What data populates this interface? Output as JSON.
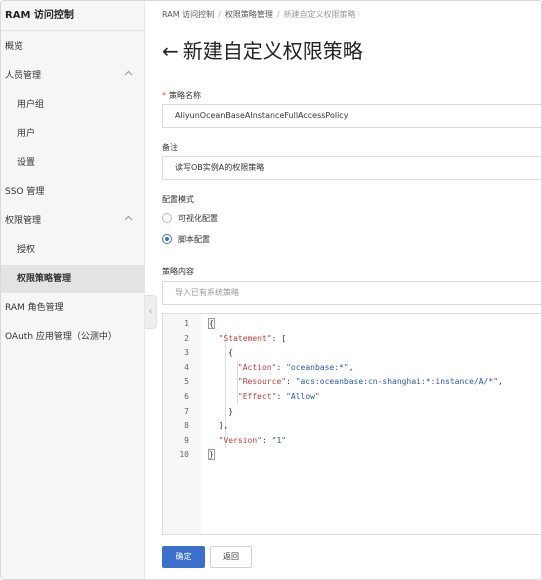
{
  "sidebar": {
    "title": "RAM 访问控制",
    "items": [
      {
        "label": "概览"
      },
      {
        "label": "人员管理"
      },
      {
        "label": "用户组"
      },
      {
        "label": "用户"
      },
      {
        "label": "设置"
      },
      {
        "label": "SSO 管理"
      },
      {
        "label": "权限管理"
      },
      {
        "label": "授权"
      },
      {
        "label": "权限策略管理"
      },
      {
        "label": "RAM 角色管理"
      },
      {
        "label": "OAuth 应用管理（公测中）"
      }
    ],
    "collapse_glyph": "‹"
  },
  "breadcrumb": {
    "items": [
      "RAM 访问控制",
      "权限策略管理",
      "新建自定义权限策略"
    ],
    "separator": "/"
  },
  "page": {
    "back_glyph": "←",
    "title": "新建自定义权限策略"
  },
  "form": {
    "policy_name_label": "策略名称",
    "required_mark": "*",
    "policy_name_value": "AliyunOceanBaseAInstanceFullAccessPolicy",
    "remark_label": "备注",
    "remark_value": "读写OB实例A的权限策略",
    "mode_label": "配置模式",
    "mode_options": [
      {
        "label": "可视化配置",
        "selected": false
      },
      {
        "label": "脚本配置",
        "selected": true
      }
    ],
    "content_label": "策略内容",
    "import_placeholder": "导入已有系统策略"
  },
  "editor": {
    "line_numbers": [
      "1",
      "2",
      "3",
      "4",
      "5",
      "6",
      "7",
      "8",
      "9",
      "10"
    ],
    "lines": [
      {
        "indent": "",
        "parts": [
          "{"
        ]
      },
      {
        "indent": "  ",
        "key": "\"Statement\"",
        "rest": ": ["
      },
      {
        "indent": "    ",
        "parts": [
          "{"
        ]
      },
      {
        "indent": "      ",
        "key": "\"Action\"",
        "sep": ": ",
        "val": "\"oceanbase:*\"",
        "tail": ","
      },
      {
        "indent": "      ",
        "key": "\"Resource\"",
        "sep": ": ",
        "val": "\"acs:oceanbase:cn-shanghai:*:instance/A/*\"",
        "tail": ","
      },
      {
        "indent": "      ",
        "key": "\"Effect\"",
        "sep": ": ",
        "val": "\"Allow\"",
        "tail": ""
      },
      {
        "indent": "    ",
        "parts": [
          "}"
        ]
      },
      {
        "indent": "  ",
        "parts": [
          "],"
        ]
      },
      {
        "indent": "  ",
        "key": "\"Version\"",
        "sep": ": ",
        "val": "\"1\"",
        "tail": ""
      },
      {
        "indent": "",
        "parts": [
          "}"
        ]
      }
    ]
  },
  "buttons": {
    "confirm": "确定",
    "back": "返回"
  },
  "colors": {
    "primary": "#3b6fce",
    "json_key": "#b5403a",
    "json_string": "#2a57b5"
  }
}
